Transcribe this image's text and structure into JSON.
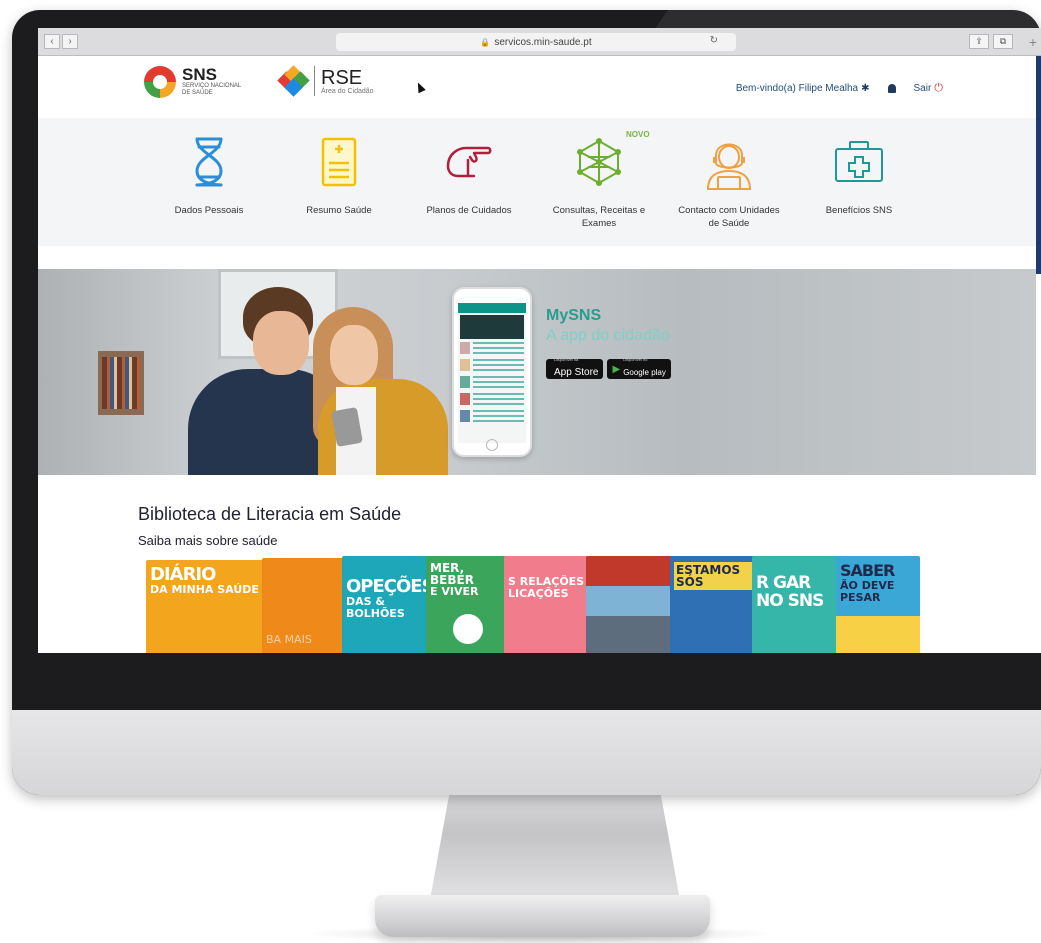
{
  "browser": {
    "url": "servicos.min-saude.pt",
    "lock_glyph": "🔒",
    "reload_glyph": "↻",
    "back_glyph": "‹",
    "forward_glyph": "›",
    "share_glyph": "⇪",
    "tabs_glyph": "⧉",
    "plus_glyph": "+"
  },
  "header": {
    "sns_logo": {
      "title": "SNS",
      "subtitle": "SERVIÇO NACIONAL DE SAÚDE"
    },
    "rse_logo": {
      "title": "RSE",
      "subtitle": "Área do Cidadão"
    },
    "welcome": "Bem-vindo(a) Filipe Mealha",
    "logout": "Sair"
  },
  "menu": {
    "badge": "NOVO",
    "items": [
      {
        "label": "Dados Pessoais",
        "icon": "dna-icon",
        "color": "#2a8fd6"
      },
      {
        "label": "Resumo Saúde",
        "icon": "document-plus-icon",
        "color": "#f2c200"
      },
      {
        "label": "Planos de Cuidados",
        "icon": "pointing-hand-icon",
        "color": "#b0203c"
      },
      {
        "label": "Consultas, Receitas e Exames",
        "icon": "network-icon",
        "color": "#6cae2d"
      },
      {
        "label": "Contacto com Unidades de Saúde",
        "icon": "support-agent-icon",
        "color": "#f0a040"
      },
      {
        "label": "Benefícios SNS",
        "icon": "medical-kit-icon",
        "color": "#1d9a95"
      }
    ]
  },
  "banner": {
    "title": "MySNS",
    "subtitle": "A app do cidadão",
    "app_store": {
      "small": "Disponível na",
      "name": "App Store"
    },
    "google_play": {
      "small": "Disponível no",
      "name": "Google play"
    }
  },
  "library": {
    "title": "Biblioteca de Literacia em Saúde",
    "subtitle": "Saiba mais sobre saúde",
    "books": [
      {
        "text": "DIÁRIO",
        "sub": "DA MINHA SAÚDE",
        "color": "#f2a51d"
      },
      {
        "text": "BA MAIS",
        "sub": "",
        "color": "#ef8a1a"
      },
      {
        "text": "OPEÇÕES",
        "sub": "DAS & BOLHÕES",
        "color": "#1ea7b8"
      },
      {
        "text": "MER, BEBER",
        "sub": "E VIVER",
        "color": "#3ba55c"
      },
      {
        "text": "S RELAÇÕES",
        "sub": "LICAÇÕES",
        "color": "#f07c8c"
      },
      {
        "text": "",
        "sub": "",
        "color": "#c0392b"
      },
      {
        "text": "ESTAMOS SÓS",
        "sub": "",
        "color": "#2f6fb3"
      },
      {
        "text": "R GAR NO SNS",
        "sub": "",
        "color": "#36b6a8"
      },
      {
        "text": "SABER",
        "sub": "ÃO DEVE PESAR",
        "color": "#3aa7d6"
      }
    ]
  }
}
